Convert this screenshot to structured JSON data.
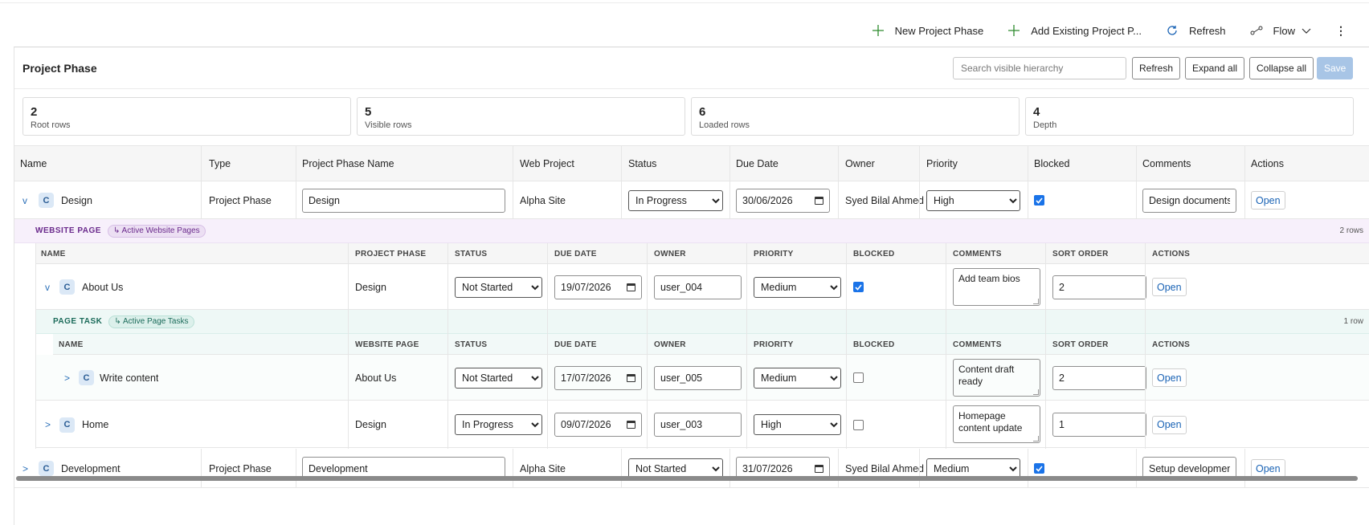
{
  "command_bar": {
    "new_phase": "New Project Phase",
    "add_existing": "Add Existing Project P...",
    "refresh": "Refresh",
    "flow": "Flow"
  },
  "panel": {
    "title": "Project Phase",
    "search_placeholder": "Search visible hierarchy",
    "refresh": "Refresh",
    "expand_all": "Expand all",
    "collapse_all": "Collapse all",
    "save": "Save"
  },
  "stats": [
    {
      "value": "2",
      "label": "Root rows"
    },
    {
      "value": "5",
      "label": "Visible rows"
    },
    {
      "value": "6",
      "label": "Loaded rows"
    },
    {
      "value": "4",
      "label": "Depth"
    }
  ],
  "columns": [
    "Name",
    "Type",
    "Project Phase Name",
    "Web Project",
    "Status",
    "Due Date",
    "Owner",
    "Priority",
    "Blocked",
    "Comments",
    "Actions"
  ],
  "rows": [
    {
      "chevron": "v",
      "badge": "C",
      "name": "Design",
      "type": "Project Phase",
      "phase_name": "Design",
      "web_project": "Alpha Site",
      "status": "In Progress",
      "due": "30/06/2026",
      "owner": "Syed Bilal Ahmed",
      "priority": "High",
      "blocked": true,
      "comments": "Design documents i",
      "action": "Open"
    },
    {
      "chevron": ">",
      "badge": "C",
      "name": "Development",
      "type": "Project Phase",
      "phase_name": "Development",
      "web_project": "Alpha Site",
      "status": "Not Started",
      "due": "31/07/2026",
      "owner": "Syed Bilal Ahmed",
      "priority": "Medium",
      "blocked": true,
      "comments": "Setup development",
      "action": "Open"
    }
  ],
  "website_section": {
    "title": "WEBSITE PAGE",
    "pill": "↳ Active Website Pages",
    "count": "2 rows",
    "columns": [
      "NAME",
      "PROJECT PHASE",
      "STATUS",
      "DUE DATE",
      "OWNER",
      "PRIORITY",
      "BLOCKED",
      "COMMENTS",
      "SORT ORDER",
      "ACTIONS"
    ],
    "rows": [
      {
        "chevron": "v",
        "badge": "C",
        "name": "About Us",
        "parent": "Design",
        "status": "Not Started",
        "due": "19/07/2026",
        "owner": "user_004",
        "priority": "Medium",
        "blocked": true,
        "comments": "Add team bios",
        "sort": "2",
        "action": "Open"
      },
      {
        "chevron": ">",
        "badge": "C",
        "name": "Home",
        "parent": "Design",
        "status": "In Progress",
        "due": "09/07/2026",
        "owner": "user_003",
        "priority": "High",
        "blocked": false,
        "comments": "Homepage content update",
        "sort": "1",
        "action": "Open"
      }
    ]
  },
  "task_section": {
    "title": "PAGE TASK",
    "pill": "↳ Active Page Tasks",
    "count": "1 row",
    "columns": [
      "NAME",
      "WEBSITE PAGE",
      "STATUS",
      "DUE DATE",
      "OWNER",
      "PRIORITY",
      "BLOCKED",
      "COMMENTS",
      "SORT ORDER",
      "ACTIONS"
    ],
    "rows": [
      {
        "chevron": ">",
        "badge": "C",
        "name": "Write content",
        "parent": "About Us",
        "status": "Not Started",
        "due": "17/07/2026",
        "owner": "user_005",
        "priority": "Medium",
        "blocked": false,
        "comments": "Content draft ready",
        "sort": "2",
        "action": "Open"
      }
    ]
  },
  "colors": {
    "accent": "#1a73e8",
    "website_bg": "#f7f0fb",
    "website_text": "#6a2a8c",
    "task_bg": "#eef8f6",
    "task_text": "#1b6b5a",
    "plus_green": "#2e8b2e"
  }
}
